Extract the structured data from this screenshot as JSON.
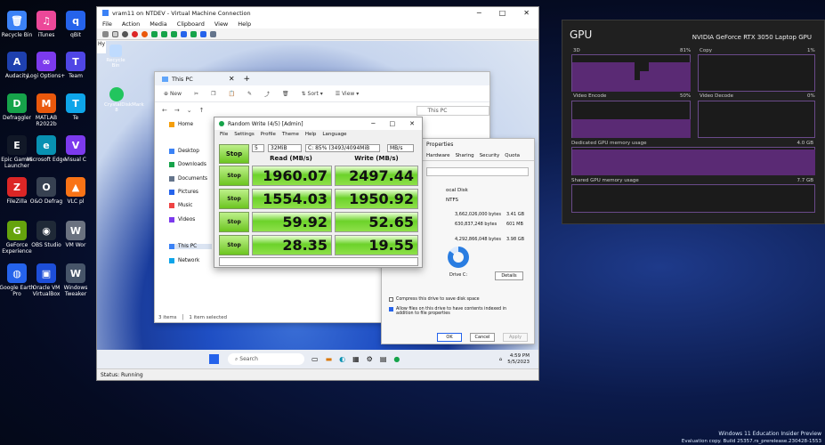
{
  "desktop_icons": [
    {
      "label": "Recycle Bin",
      "color": "#3b82f6",
      "glyph": "🗑"
    },
    {
      "label": "iTunes",
      "color": "#ec4899",
      "glyph": "♫"
    },
    {
      "label": "qBit",
      "color": "#2563eb",
      "glyph": "q"
    },
    {
      "label": "Audacity",
      "color": "#1e40af",
      "glyph": "A"
    },
    {
      "label": "Logi Options+",
      "color": "#7c3aed",
      "glyph": "∞"
    },
    {
      "label": "Team",
      "color": "#4f46e5",
      "glyph": "T"
    },
    {
      "label": "Defraggler",
      "color": "#16a34a",
      "glyph": "D"
    },
    {
      "label": "MATLAB R2022b",
      "color": "#ea580c",
      "glyph": "M"
    },
    {
      "label": "Te",
      "color": "#0ea5e9",
      "glyph": "T"
    },
    {
      "label": "Epic Games Launcher",
      "color": "#111827",
      "glyph": "E"
    },
    {
      "label": "Microsoft Edge",
      "color": "#0891b2",
      "glyph": "e"
    },
    {
      "label": "Visual C",
      "color": "#7c3aed",
      "glyph": "V"
    },
    {
      "label": "FileZilla",
      "color": "#dc2626",
      "glyph": "Z"
    },
    {
      "label": "O&O Defrag",
      "color": "#374151",
      "glyph": "O"
    },
    {
      "label": "VLC pl",
      "color": "#f97316",
      "glyph": "▲"
    },
    {
      "label": "GeForce Experience",
      "color": "#65a30d",
      "glyph": "G"
    },
    {
      "label": "OBS Studio",
      "color": "#1f2937",
      "glyph": "◉"
    },
    {
      "label": "VM Wor",
      "color": "#6b7280",
      "glyph": "W"
    },
    {
      "label": "Google Earth Pro",
      "color": "#2563eb",
      "glyph": "◍"
    },
    {
      "label": "Oracle VM VirtualBox",
      "color": "#1d4ed8",
      "glyph": "▣"
    },
    {
      "label": "Windows Tweaker",
      "color": "#475569",
      "glyph": "W"
    }
  ],
  "vm": {
    "title": "vram11 on NTDEV - Virtual Machine Connection",
    "menu": [
      "File",
      "Action",
      "Media",
      "Clipboard",
      "View",
      "Help"
    ],
    "status": "Status: Running"
  },
  "guest": {
    "desktop_icons": [
      {
        "label": "Recycle Bin"
      },
      {
        "label": "CrystalDiskMark 8"
      }
    ],
    "hyper_tab": "Hy",
    "explorer": {
      "title": "This PC",
      "new_label": "New",
      "sort_label": "Sort",
      "view_label": "View",
      "address": "This PC",
      "nav": [
        "Home",
        "Desktop",
        "Downloads",
        "Documents",
        "Pictures",
        "Music",
        "Videos",
        "This PC",
        "Network"
      ],
      "status_items": "3 items",
      "status_selected": "1 item selected"
    },
    "taskbar": {
      "search": "Search",
      "time": "4:59 PM",
      "date": "5/5/2023"
    }
  },
  "cdm": {
    "title": "Random Write (4/5) [Admin]",
    "menu": [
      "File",
      "Settings",
      "Profile",
      "Theme",
      "Help",
      "Language"
    ],
    "count": "5",
    "size": "32MiB",
    "drive": "C: 85% (3493/4094MiB",
    "unit": "MB/s",
    "all_label": "Stop",
    "read_header": "Read (MB/s)",
    "write_header": "Write (MB/s)",
    "rows": [
      {
        "button": "Stop",
        "read": "1960.07",
        "write": "2497.44"
      },
      {
        "button": "Stop",
        "read": "1554.03",
        "write": "1950.92"
      },
      {
        "button": "Stop",
        "read": "59.92",
        "write": "52.65"
      },
      {
        "button": "Stop",
        "read": "28.35",
        "write": "19.55"
      }
    ]
  },
  "props": {
    "title": "Properties",
    "tabs": [
      "Hardware",
      "Sharing",
      "Security",
      "Quota"
    ],
    "type_label": "ocal Disk",
    "fs_label": "NTFS",
    "used_bytes": "3,662,026,000 bytes",
    "used_gb": "3.41 GB",
    "free_bytes": "630,837,248 bytes",
    "free_gb": "601 MB",
    "cap_bytes": "4,292,866,048 bytes",
    "cap_gb": "3.98 GB",
    "drive_label": "Drive C:",
    "details": "Details",
    "compress": "Compress this drive to save disk space",
    "index": "Allow files on this drive to have contents indexed in addition to file properties",
    "ok": "OK",
    "cancel": "Cancel",
    "apply": "Apply"
  },
  "gpu": {
    "title": "GPU",
    "model": "NVIDIA GeForce RTX 3050 Laptop GPU",
    "graphs": [
      {
        "name": "3D",
        "pct": "81%"
      },
      {
        "name": "Copy",
        "pct": "1%"
      },
      {
        "name": "Video Encode",
        "pct": "50%"
      },
      {
        "name": "Video Decode",
        "pct": "0%"
      }
    ],
    "dedicated_label": "Dedicated GPU memory usage",
    "dedicated_max": "4.0 GB",
    "shared_label": "Shared GPU memory usage",
    "shared_max": "7.7 GB"
  },
  "watermark": {
    "line1": "Windows 11 Education Insider Preview",
    "line2": "Evaluation copy. Build 25357.rs_prerelease.230428-1553"
  },
  "colors": {
    "cdm_green": "#6cc520",
    "gpu_purple": "#5a2a74"
  }
}
